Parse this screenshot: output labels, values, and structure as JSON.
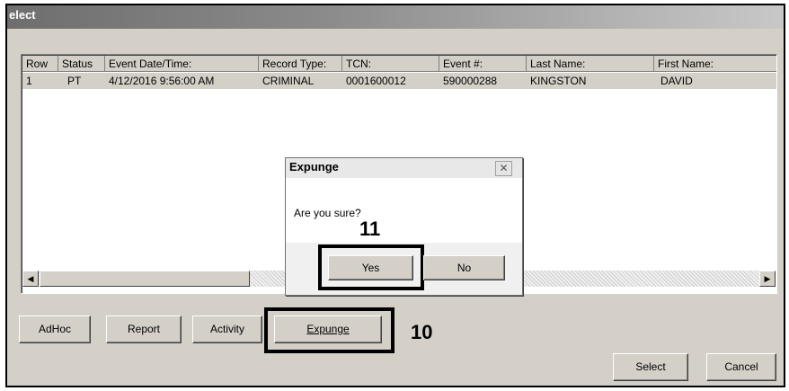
{
  "window": {
    "title": "elect"
  },
  "listview": {
    "columns": [
      "Row",
      "Status",
      "Event Date/Time:",
      "Record Type:",
      "TCN:",
      "Event #:",
      "Last Name:",
      "First Name:"
    ],
    "rows": [
      [
        "1",
        "PT",
        "4/12/2016 9:56:00 AM",
        "CRIMINAL",
        "0001600012",
        "590000288",
        "KINGSTON",
        "DAVID"
      ]
    ]
  },
  "scrollbar": {
    "left_arrow": "◀",
    "right_arrow": "▶"
  },
  "toolbar": {
    "adhoc": "AdHoc",
    "report": "Report",
    "activity": "Activity",
    "expunge": "Expunge",
    "select": "Select",
    "cancel": "Cancel"
  },
  "callouts": {
    "expunge_step": "10",
    "yes_step": "11"
  },
  "dialog": {
    "title": "Expunge",
    "close": "✕",
    "message": "Are you sure?",
    "yes": "Yes",
    "no": "No"
  }
}
